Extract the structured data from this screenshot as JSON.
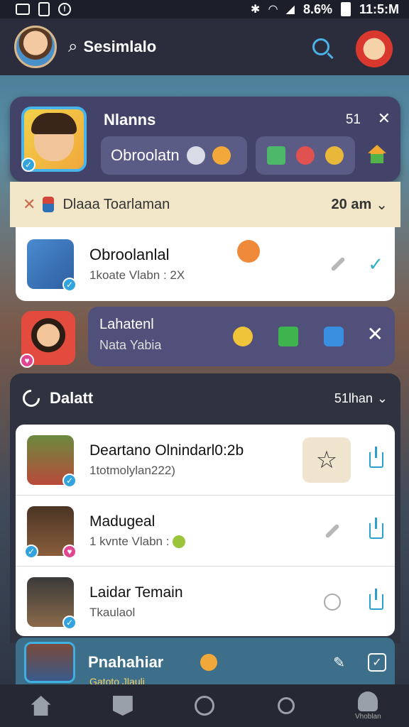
{
  "status_bar": {
    "battery": "8.6%",
    "time": "11:5:M"
  },
  "top_bar": {
    "title": "Sesimlalo"
  },
  "featured": {
    "name": "Nlanns",
    "count": "51",
    "chip_label": "Obroolatn"
  },
  "section_band": {
    "label": "Dlaaa Toarlaman",
    "time": "20 am"
  },
  "contact1": {
    "title": "Obroolanlal",
    "sub": "1koate Vlabn : 2X"
  },
  "contact2": {
    "title": "Lahatenl",
    "sub": "Nata Yabia"
  },
  "panel": {
    "title": "Dalatt",
    "sort": "51lhan"
  },
  "list": [
    {
      "title": "Deartano Olnindarl0:2b",
      "sub": "1totmolylan222)"
    },
    {
      "title": "Madugeal",
      "sub": "1 kvnte Vlabn :"
    },
    {
      "title": "Laidar Temain",
      "sub": "Tkaulaol"
    }
  ],
  "last_item": {
    "title": "Pnahahiar",
    "sub": "Gatoto Jlauli"
  },
  "nav": {
    "profile_label": "Vhoblan"
  },
  "colors": {
    "accent": "#4ab2e6",
    "check": "#2fb2c8",
    "card": "#43436a"
  }
}
